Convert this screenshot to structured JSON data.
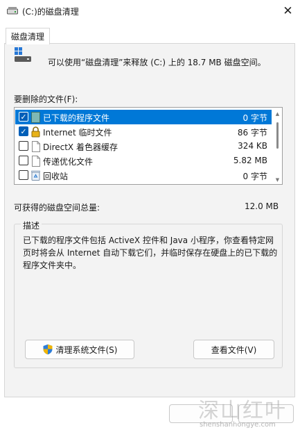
{
  "window": {
    "title": "(C:)的磁盘清理",
    "close_glyph": "✕"
  },
  "tab": {
    "label": "磁盘清理"
  },
  "summary": {
    "text": "可以使用“磁盘清理”来释放  (C:) 上的 18.7 MB 磁盘空间。"
  },
  "files": {
    "label": "要删除的文件(F):",
    "items": [
      {
        "name": "已下载的程序文件",
        "size": "0 字节",
        "checked": true,
        "selected": true,
        "icon": "folder-icon"
      },
      {
        "name": "Internet 临时文件",
        "size": "86 字节",
        "checked": true,
        "selected": false,
        "icon": "lock-icon"
      },
      {
        "name": "DirectX 着色器缓存",
        "size": "324 KB",
        "checked": false,
        "selected": false,
        "icon": "file-icon"
      },
      {
        "name": "传递优化文件",
        "size": "5.82 MB",
        "checked": false,
        "selected": false,
        "icon": "file-icon"
      },
      {
        "name": "回收站",
        "size": "0 字节",
        "checked": false,
        "selected": false,
        "icon": "recycle-bin-icon"
      }
    ],
    "check_glyph": "✓"
  },
  "total": {
    "label": "可获得的磁盘空间总量:",
    "value": "12.0 MB"
  },
  "description": {
    "legend": "描述",
    "text": "已下载的程序文件包括 ActiveX 控件和 Java 小程序，你查看特定网页时将会从 Internet 自动下载它们，并临时保存在硬盘上的已下载的程序文件夹中。"
  },
  "buttons": {
    "cleanup_system": "清理系统文件(S)",
    "view_files": "查看文件(V)",
    "ok": "",
    "cancel": ""
  },
  "watermark": {
    "big": "深山红叶",
    "small": "shenshanhongye.com"
  },
  "colors": {
    "selection": "#0078d7",
    "check": "#005fb8",
    "panel": "#f3f3f3",
    "shield": "#2e7dd7",
    "shield_accent": "#f0b400"
  }
}
